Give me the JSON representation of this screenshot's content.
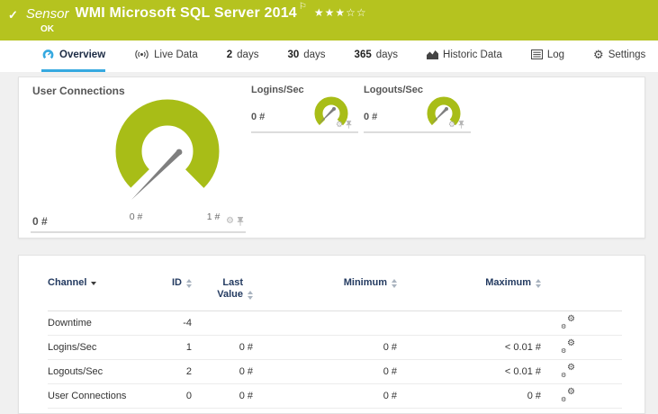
{
  "colors": {
    "brand-green": "#b5c31f",
    "gauge-green": "#a8bd17",
    "blue": "#36a9e0",
    "navy": "#233a60",
    "page-bg": "#f0f0f0"
  },
  "icons": {
    "check": "✓",
    "flag": "⚐",
    "gear": "⚙",
    "stars": "★★★☆☆"
  },
  "titlebar": {
    "type": "Sensor",
    "title": "WMI Microsoft SQL Server 2014",
    "status": "OK"
  },
  "tabs": {
    "overview": {
      "label": "Overview"
    },
    "live_data": {
      "label": "Live Data"
    },
    "d2": {
      "num": "2",
      "unit": "days"
    },
    "d30": {
      "num": "30",
      "unit": "days"
    },
    "d365": {
      "num": "365",
      "unit": "days"
    },
    "historic": {
      "label": "Historic Data"
    },
    "log": {
      "label": "Log"
    },
    "settings": {
      "label": "Settings"
    }
  },
  "gauges": {
    "user_connections": {
      "title": "User Connections",
      "value": "0 #",
      "scale_min": "0 #",
      "scale_max": "1 #"
    },
    "logins": {
      "title": "Logins/Sec",
      "value": "0 #"
    },
    "logouts": {
      "title": "Logouts/Sec",
      "value": "0 #"
    }
  },
  "table": {
    "headers": {
      "channel": "Channel",
      "id": "ID",
      "last_value": "Last Value",
      "minimum": "Minimum",
      "maximum": "Maximum"
    },
    "rows": [
      {
        "channel": "Downtime",
        "id": "-4",
        "last": "",
        "min": "",
        "max": ""
      },
      {
        "channel": "Logins/Sec",
        "id": "1",
        "last": "0 #",
        "min": "0 #",
        "max": "< 0.01 #"
      },
      {
        "channel": "Logouts/Sec",
        "id": "2",
        "last": "0 #",
        "min": "0 #",
        "max": "< 0.01 #"
      },
      {
        "channel": "User Connections",
        "id": "0",
        "last": "0 #",
        "min": "0 #",
        "max": "0 #"
      }
    ]
  }
}
